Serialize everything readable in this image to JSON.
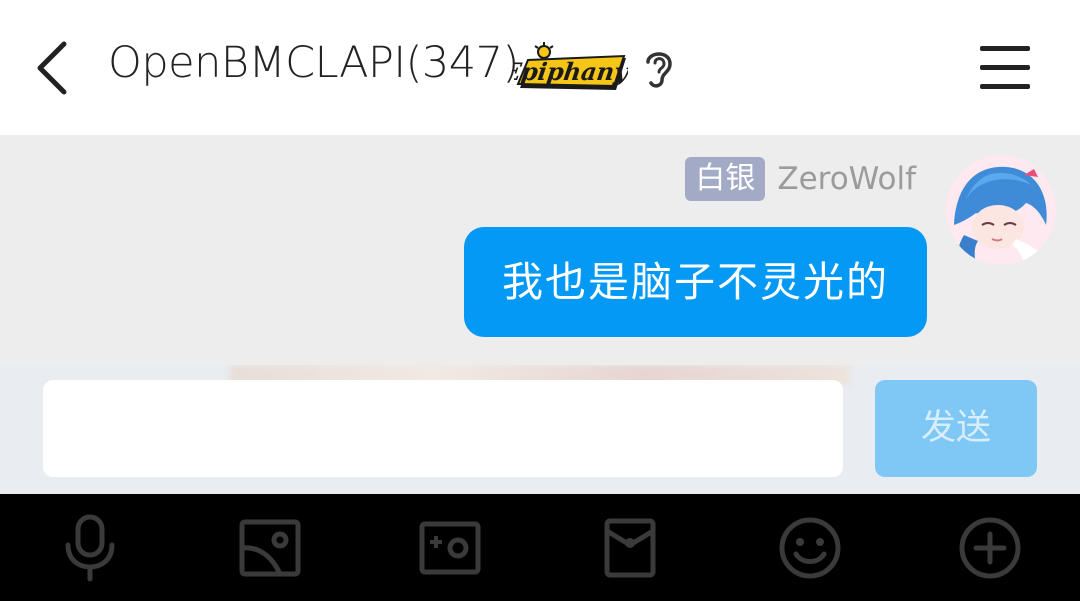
{
  "header": {
    "title": "OpenBMCLAPI(347)",
    "logo_text": "Epiphany",
    "icons": {
      "back": "chevron-left-icon",
      "listen": "ear-icon",
      "menu": "menu-icon"
    }
  },
  "message": {
    "badge": "白银",
    "sender": "ZeroWolf",
    "text": "我也是脑子不灵光的"
  },
  "composer": {
    "input_value": "",
    "send_label": "发送"
  },
  "toolbar": {
    "items": [
      "microphone-icon",
      "image-icon",
      "camera-icon",
      "red-packet-icon",
      "emoji-icon",
      "plus-icon"
    ]
  },
  "colors": {
    "bubble": "#0399f5",
    "badge": "#a2aac5",
    "send_button": "#7fc7f4",
    "toolbar_background": "#000000",
    "toolbar_icon": "#3a3a3a"
  }
}
